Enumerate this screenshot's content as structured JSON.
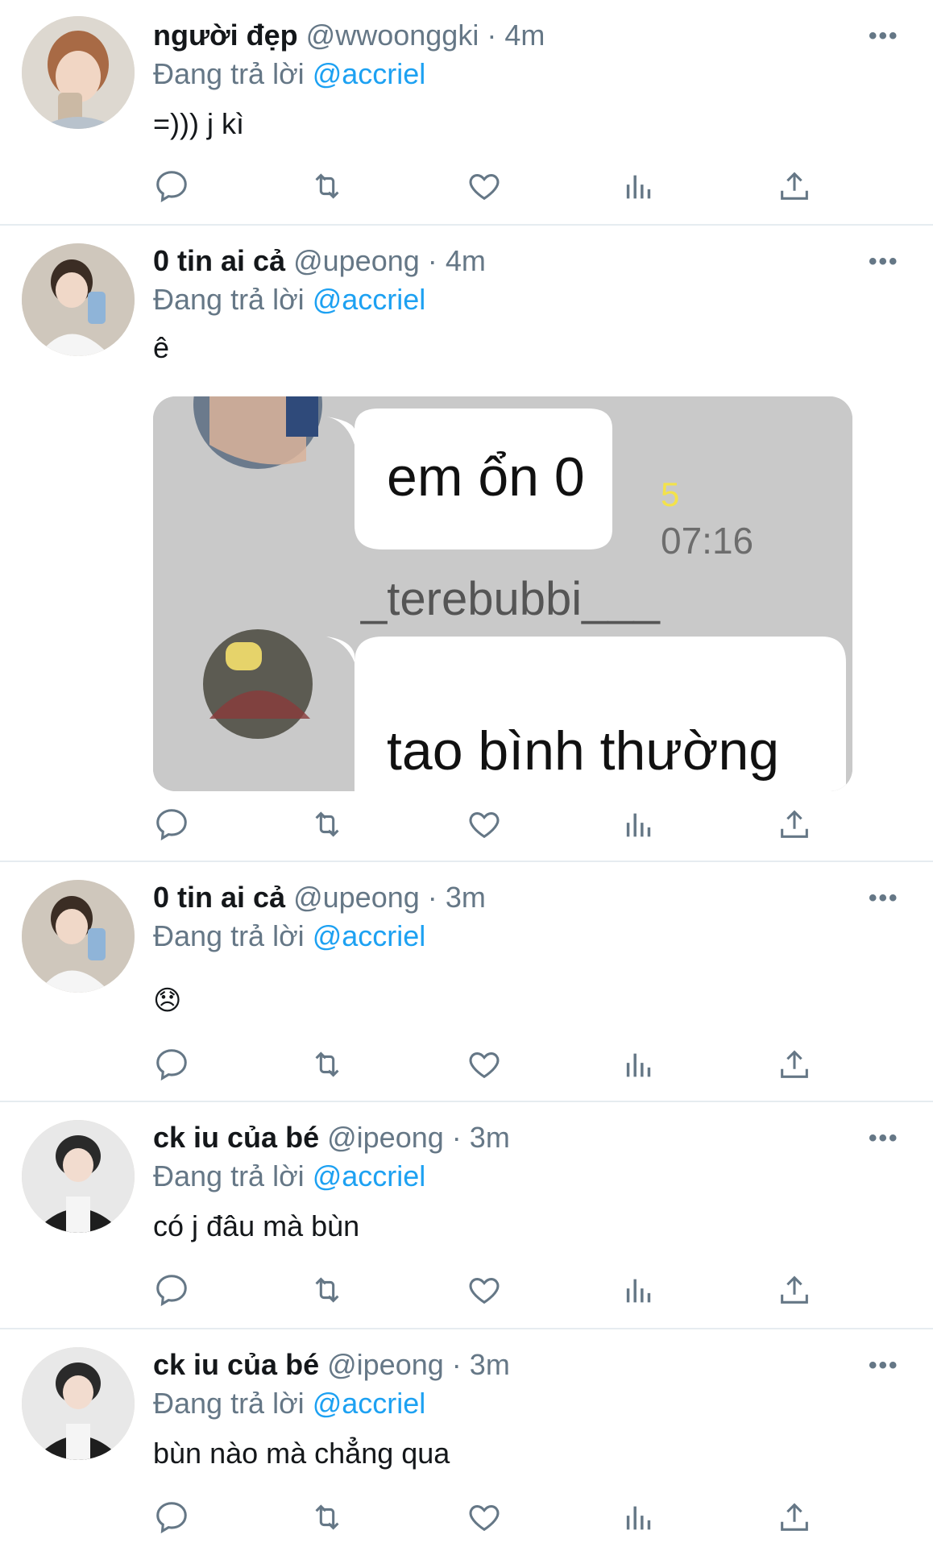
{
  "colors": {
    "accent": "#1da1f2",
    "secondary": "#657786",
    "divider": "#e6ecf0"
  },
  "tweets": [
    {
      "name": "người đẹp",
      "handle": "@wwoonggki",
      "time": "4m",
      "reply_prefix": "Đang trả lời",
      "mention": "@accriel",
      "text": "=))) j kì"
    },
    {
      "name": "0 tin ai cả",
      "handle": "@upeong",
      "time": "4m",
      "reply_prefix": "Đang trả lời",
      "mention": "@accriel",
      "text": "ê",
      "media": {
        "bubble1": "em ổn 0",
        "read_count": "5",
        "time": "07:16",
        "sender": "_terebubbi___",
        "bubble2": "tao bình thường"
      }
    },
    {
      "name": "0 tin ai cả",
      "handle": "@upeong",
      "time": "3m",
      "reply_prefix": "Đang trả lời",
      "mention": "@accriel",
      "text": "😞"
    },
    {
      "name": "ck iu của bé",
      "handle": "@ipeong",
      "time": "3m",
      "reply_prefix": "Đang trả lời",
      "mention": "@accriel",
      "text": "có j đâu mà bùn"
    },
    {
      "name": "ck iu của bé",
      "handle": "@ipeong",
      "time": "3m",
      "reply_prefix": "Đang trả lời",
      "mention": "@accriel",
      "text": "bùn nào mà chẳng qua"
    }
  ],
  "separator": "·",
  "more_label": "•••",
  "icons": [
    "reply-icon",
    "retweet-icon",
    "like-icon",
    "analytics-icon",
    "share-icon"
  ]
}
